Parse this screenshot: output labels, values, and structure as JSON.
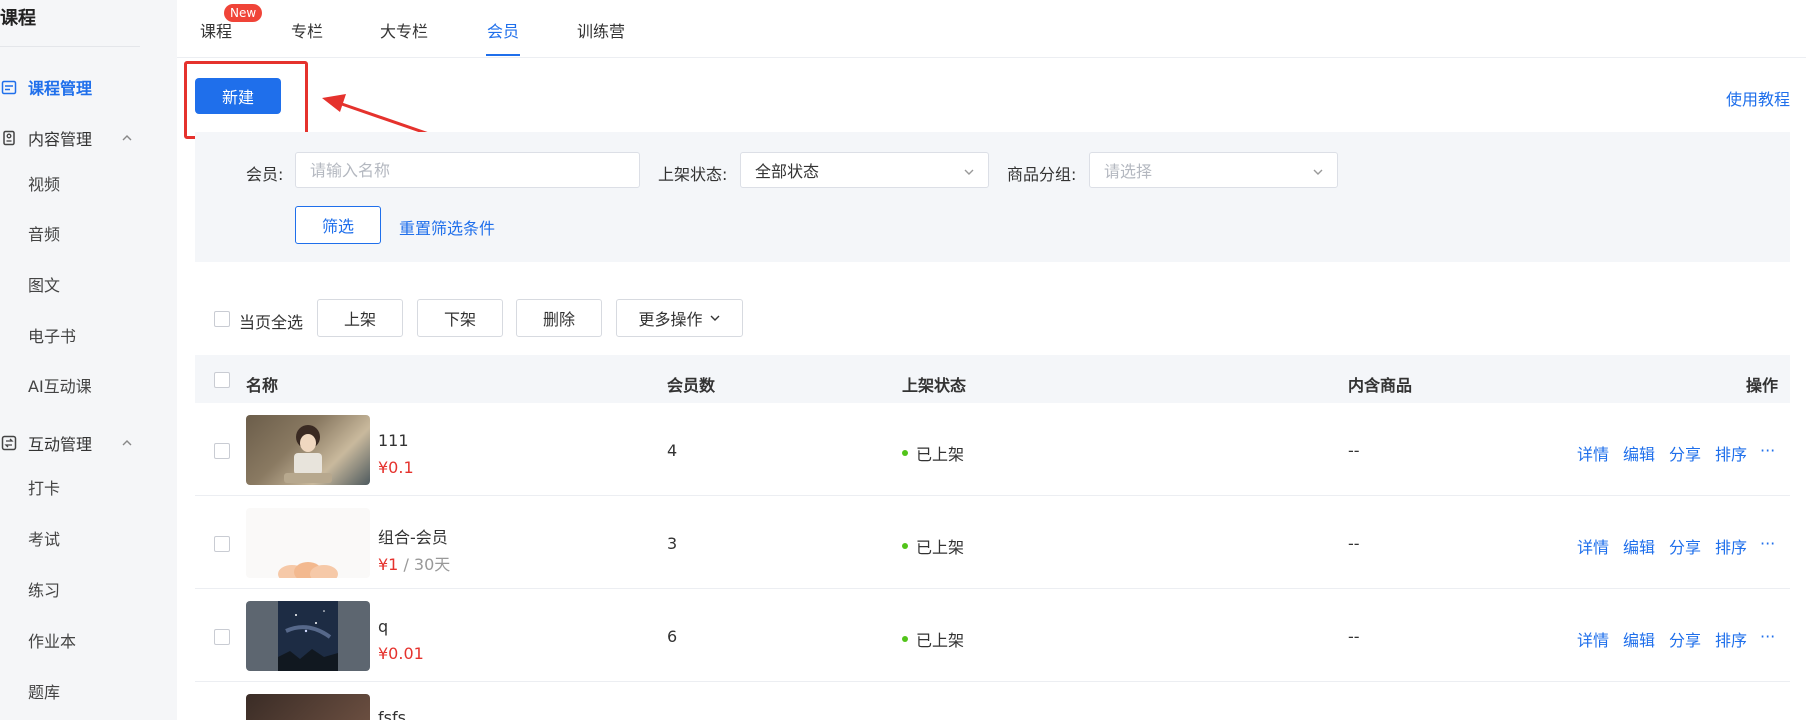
{
  "sidebar": {
    "title": "课程",
    "course_mgmt": "课程管理",
    "content_mgmt": "内容管理",
    "content_items": [
      "视频",
      "音频",
      "图文",
      "电子书",
      "AI互动课"
    ],
    "interact_mgmt": "互动管理",
    "interact_items": [
      "打卡",
      "考试",
      "练习",
      "作业本",
      "题库"
    ]
  },
  "tabs": {
    "items": [
      "课程",
      "专栏",
      "大专栏",
      "会员",
      "训练营"
    ],
    "active": "会员",
    "new_badge": "New"
  },
  "toolbar": {
    "new_label": "新建",
    "help_label": "使用教程"
  },
  "filter": {
    "member_label": "会员:",
    "member_placeholder": "请输入名称",
    "status_label": "上架状态:",
    "status_value": "全部状态",
    "group_label": "商品分组:",
    "group_placeholder": "请选择",
    "filter_btn": "筛选",
    "reset_link": "重置筛选条件"
  },
  "bulk": {
    "select_all": "当页全选",
    "on_shelf": "上架",
    "off_shelf": "下架",
    "delete": "删除",
    "more": "更多操作"
  },
  "table": {
    "headers": {
      "name": "名称",
      "count": "会员数",
      "status": "上架状态",
      "goods": "内含商品",
      "ops": "操作"
    },
    "actions": [
      "详情",
      "编辑",
      "分享",
      "排序",
      "···"
    ],
    "rows": [
      {
        "name": "111",
        "price": "¥0.1",
        "duration": "",
        "count": "4",
        "status": "已上架",
        "goods": "--"
      },
      {
        "name": "组合-会员",
        "price": "¥1",
        "duration": " / 30天",
        "count": "3",
        "status": "已上架",
        "goods": "--"
      },
      {
        "name": "q",
        "price": "¥0.01",
        "duration": "",
        "count": "6",
        "status": "已上架",
        "goods": "--"
      },
      {
        "name": "fsfs",
        "price": "",
        "duration": "",
        "count": "",
        "status": "",
        "goods": ""
      }
    ]
  },
  "colors": {
    "accent": "#1f6feb",
    "danger": "#e5322d",
    "success": "#52c41a"
  }
}
